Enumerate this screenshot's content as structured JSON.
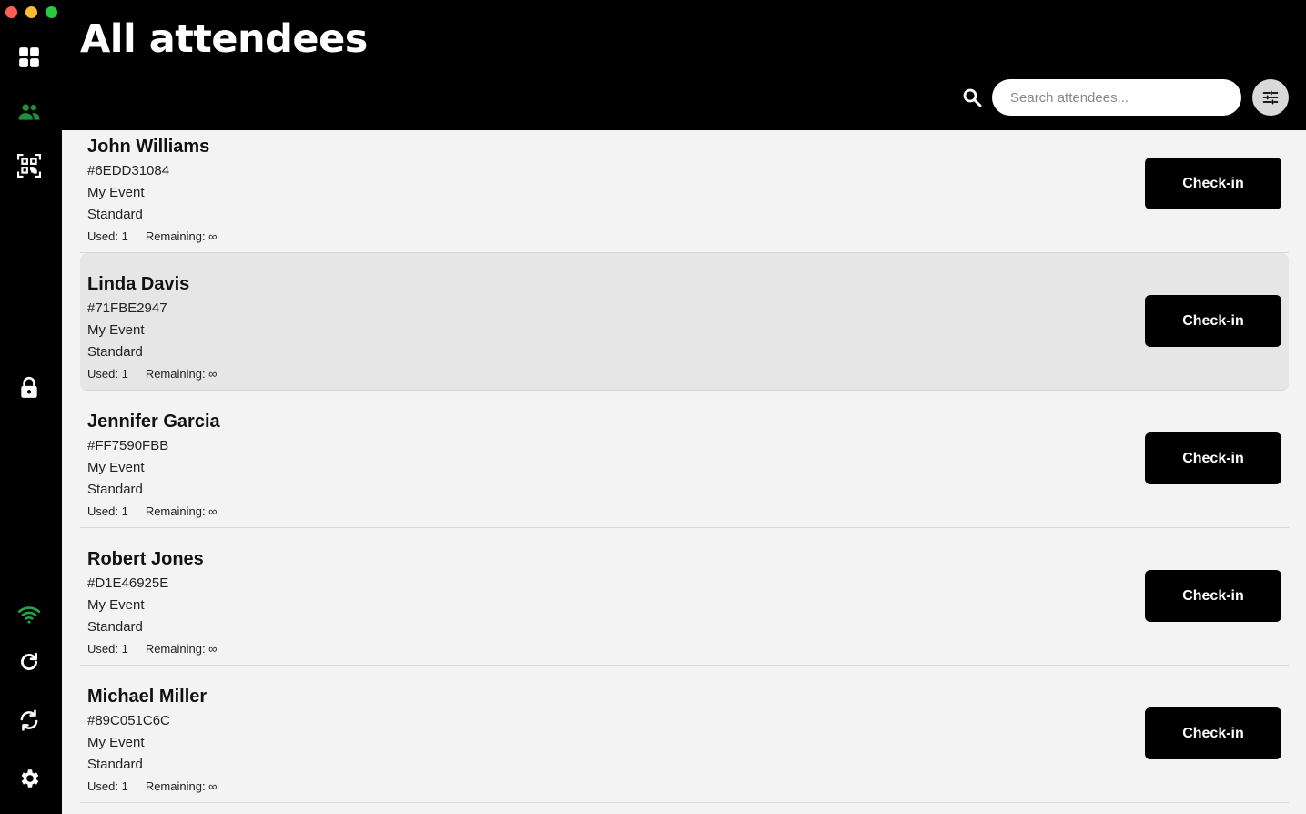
{
  "window": {
    "controls": [
      "close",
      "minimize",
      "maximize"
    ]
  },
  "sidebar": {
    "items": [
      {
        "icon": "dashboard-grid-icon",
        "active": false
      },
      {
        "icon": "attendees-people-icon",
        "active": true
      },
      {
        "icon": "qr-scan-icon",
        "active": false
      },
      {
        "icon": "lock-icon",
        "active": false
      },
      {
        "icon": "wifi-icon",
        "active": false
      },
      {
        "icon": "refresh-icon",
        "active": false
      },
      {
        "icon": "sync-icon",
        "active": false
      },
      {
        "icon": "settings-gear-icon",
        "active": false
      }
    ],
    "colors": {
      "active": "#1f8f3a",
      "wifi": "#1fa84a",
      "default": "#ffffff"
    }
  },
  "header": {
    "title": "All attendees",
    "search_placeholder": "Search attendees..."
  },
  "attendees": [
    {
      "name": "John Williams",
      "id": "#6EDD31084",
      "event": "My Event",
      "ticket": "Standard",
      "used": "Used: 1",
      "remaining": "Remaining: ∞",
      "button": "Check-in"
    },
    {
      "name": "Linda Davis",
      "id": "#71FBE2947",
      "event": "My Event",
      "ticket": "Standard",
      "used": "Used: 1",
      "remaining": "Remaining: ∞",
      "button": "Check-in"
    },
    {
      "name": "Jennifer Garcia",
      "id": "#FF7590FBB",
      "event": "My Event",
      "ticket": "Standard",
      "used": "Used: 1",
      "remaining": "Remaining: ∞",
      "button": "Check-in"
    },
    {
      "name": "Robert Jones",
      "id": "#D1E46925E",
      "event": "My Event",
      "ticket": "Standard",
      "used": "Used: 1",
      "remaining": "Remaining: ∞",
      "button": "Check-in"
    },
    {
      "name": "Michael Miller",
      "id": "#89C051C6C",
      "event": "My Event",
      "ticket": "Standard",
      "used": "Used: 1",
      "remaining": "Remaining: ∞",
      "button": "Check-in"
    }
  ]
}
